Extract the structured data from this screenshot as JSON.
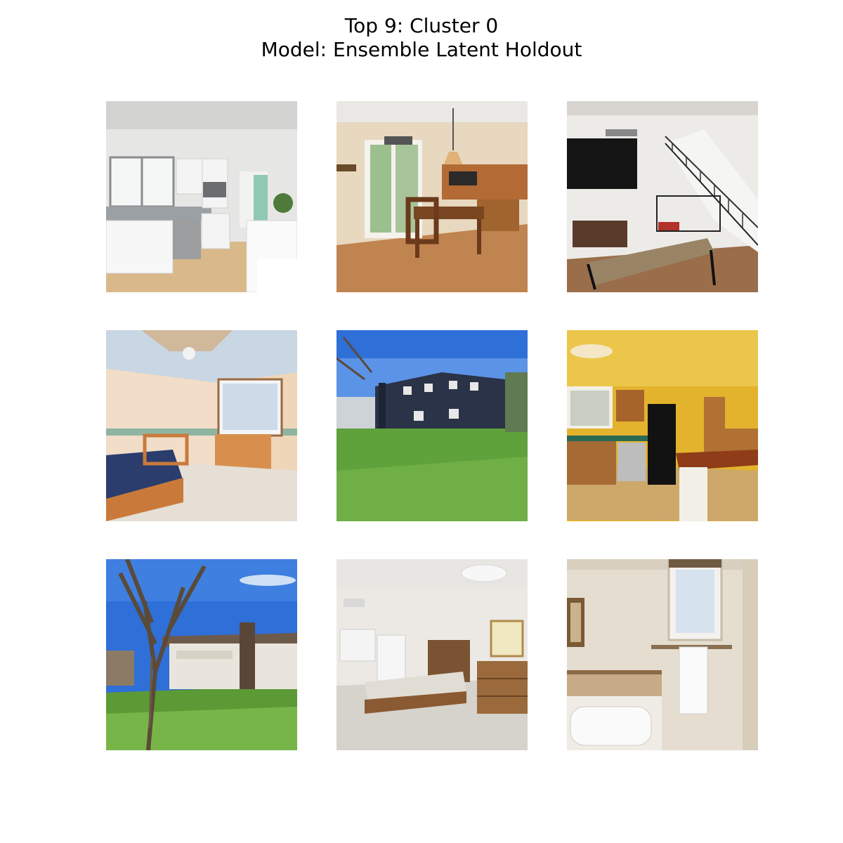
{
  "title": {
    "line1": "Top 9: Cluster 0",
    "line2": "Model: Ensemble Latent Holdout"
  },
  "images": [
    {
      "scene": "white kitchen with window and wood floor"
    },
    {
      "scene": "dining room with pendant light and sliding glass door"
    },
    {
      "scene": "living room with staircase, TV and stone coffee table"
    },
    {
      "scene": "bedroom with ceiling fan, window and wooden dresser"
    },
    {
      "scene": "two-story dark blue house with green lawn"
    },
    {
      "scene": "yellow kitchen with black refrigerator and wood cabinets"
    },
    {
      "scene": "single-story white house with bare tree under blue sky"
    },
    {
      "scene": "bedroom with wooden bed, dresser and ceiling light"
    },
    {
      "scene": "bathroom with bathtub, window and hanging towel"
    }
  ]
}
